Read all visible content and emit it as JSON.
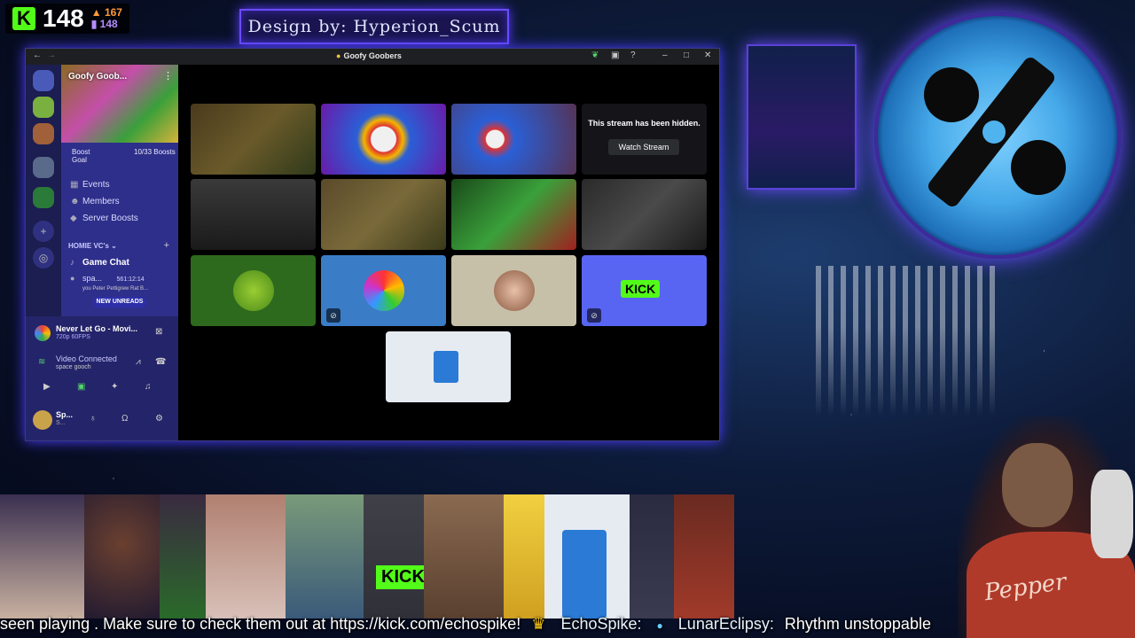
{
  "stats": {
    "main_count": "148",
    "sub_top": "167",
    "sub_bottom": "148"
  },
  "design_banner": "Design by: Hyperion_Scum",
  "discord": {
    "window_title": "Goofy Goobers",
    "server_name": "Goofy Goob...",
    "boost_goal": "Boost Goal",
    "boost_count": "10/33 Boosts",
    "channels": [
      {
        "label": "Events",
        "icon": "calendar-icon"
      },
      {
        "label": "Members",
        "icon": "members-icon"
      },
      {
        "label": "Server Boosts",
        "icon": "boost-icon"
      }
    ],
    "category": "HOMIE VC's",
    "voice_channel": "Game Chat",
    "voice_user": "spa...",
    "voice_user_meta": "561:12:14",
    "voice_status": "you Peter Pettigrew Rat B...",
    "new_unreads": "NEW UNREADS",
    "now_playing_title": "Never Let Go - Movi...",
    "now_playing_sub": "720p 60FPS",
    "voice_connected": "Video Connected",
    "voice_connected_sub": "space gooch",
    "user_name": "Sp...",
    "user_status": "S...",
    "stream_hidden_msg": "This stream has been hidden.",
    "watch_stream": "Watch Stream"
  },
  "ticker": {
    "text_1": "seen playing . Make sure to check them out at https://kick.com/echospike!",
    "name_1": "EchoSpike:",
    "name_2": "LunarEclipsy:",
    "text_2": "Rhythm unstoppable"
  },
  "overlay": {
    "shirt_brand": "Pepper"
  }
}
